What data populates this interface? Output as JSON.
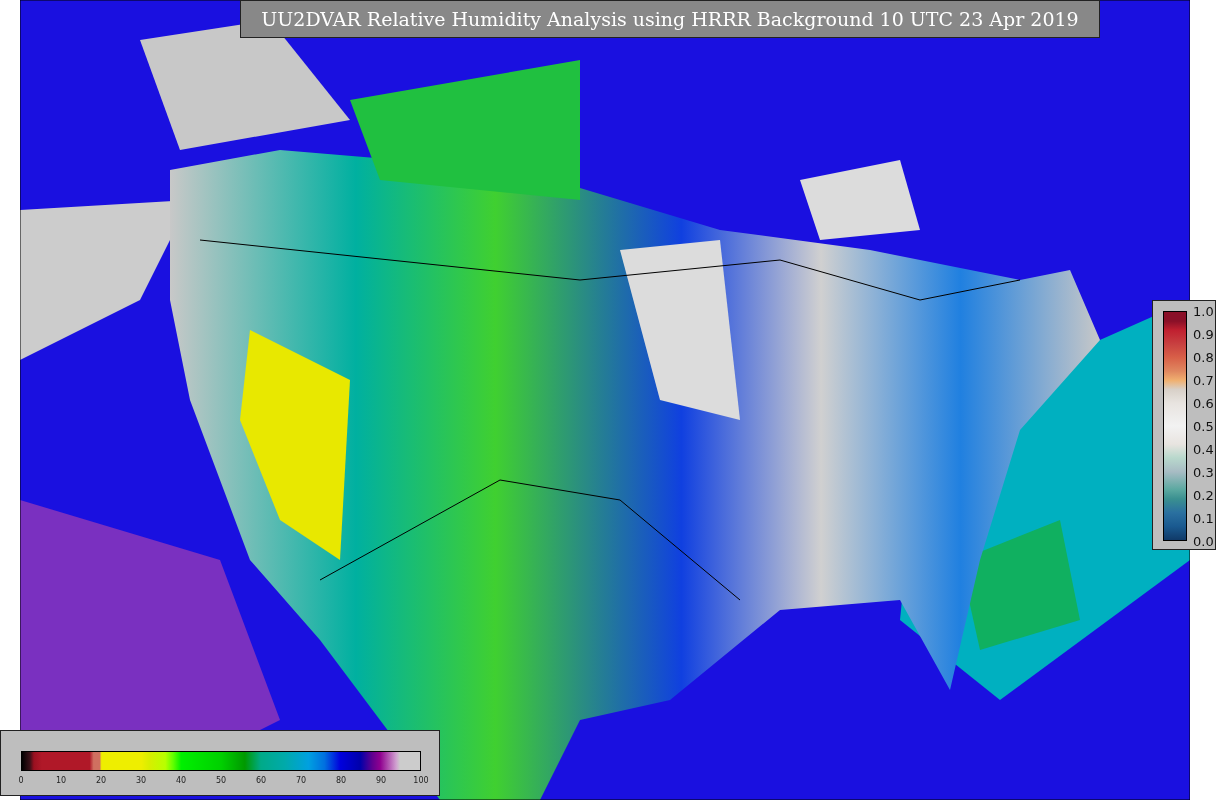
{
  "title": "UU2DVAR Relative Humidity Analysis using HRRR Background 10 UTC 23 Apr 2019",
  "humidity_colorbar": {
    "ticks": [
      "0",
      "10",
      "20",
      "30",
      "40",
      "50",
      "60",
      "70",
      "80",
      "90",
      "100"
    ]
  },
  "observation_colorbar": {
    "ticks": [
      "1.0",
      "0.9",
      "0.8",
      "0.7",
      "0.6",
      "0.5",
      "0.4",
      "0.3",
      "0.2",
      "0.1",
      "0.0"
    ]
  }
}
